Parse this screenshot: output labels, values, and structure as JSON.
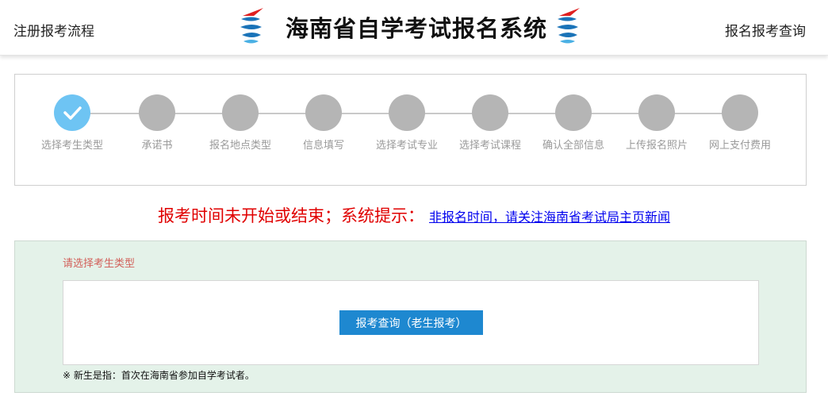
{
  "header": {
    "left_link": "注册报考流程",
    "title": "海南省自学考试报名系统",
    "right_link": "报名报考查询"
  },
  "steps": [
    {
      "label": "选择考生类型",
      "status": "done"
    },
    {
      "label": "承诺书",
      "status": "pending"
    },
    {
      "label": "报名地点类型",
      "status": "pending"
    },
    {
      "label": "信息填写",
      "status": "pending"
    },
    {
      "label": "选择考试专业",
      "status": "pending"
    },
    {
      "label": "选择考试课程",
      "status": "pending"
    },
    {
      "label": "确认全部信息",
      "status": "pending"
    },
    {
      "label": "上传报名照片",
      "status": "pending"
    },
    {
      "label": "网上支付费用",
      "status": "pending"
    }
  ],
  "notice": {
    "text": "报考时间未开始或结束；系统提示：",
    "link": "非报名时间，请关注海南省考试局主页新闻"
  },
  "selection": {
    "title": "请选择考生类型",
    "button_label": "报考查询（老生报考）",
    "footnote": "※ 新生是指：首次在海南省参加自学考试者。"
  },
  "colors": {
    "step_done": "#6ec4f3",
    "step_pending": "#b5b5b5",
    "notice": "#e00000",
    "button": "#1e88d0",
    "panel_bg": "#e4f2e9"
  }
}
